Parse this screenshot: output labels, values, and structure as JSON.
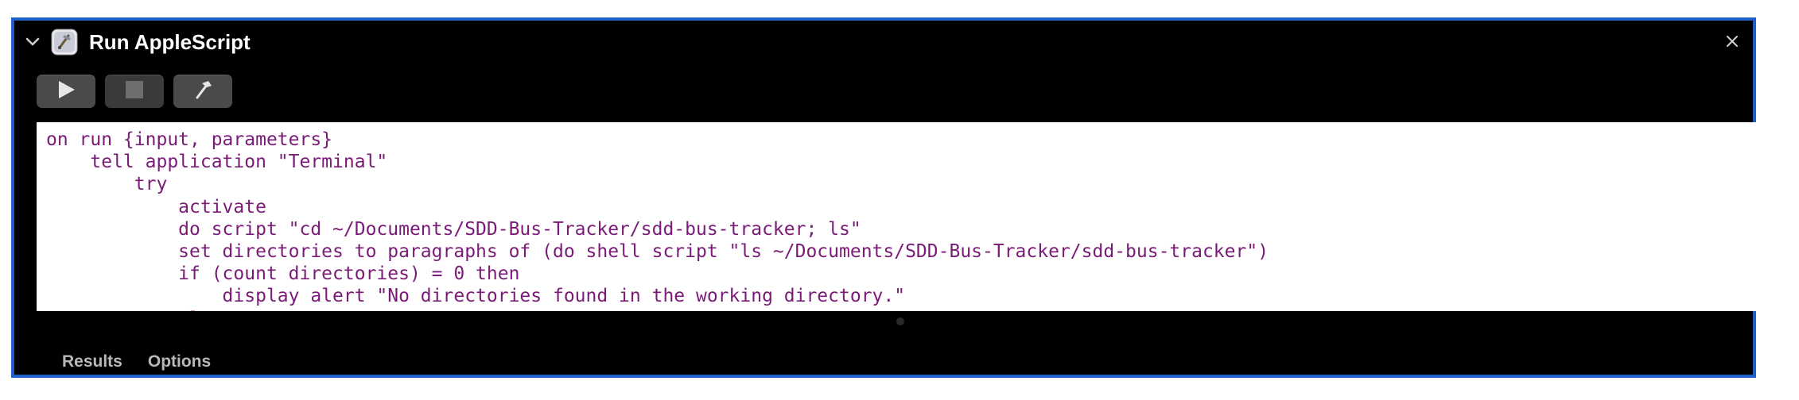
{
  "panel": {
    "title": "Run AppleScript",
    "icons": {
      "disclosure": "chevron-down-icon",
      "app": "script-editor-icon",
      "close": "close-icon"
    }
  },
  "toolbar": {
    "buttons": [
      {
        "name": "run",
        "icon": "play-icon"
      },
      {
        "name": "stop",
        "icon": "stop-icon"
      },
      {
        "name": "compile",
        "icon": "hammer-icon"
      }
    ]
  },
  "editor": {
    "code_color": "#7a1b78",
    "lines": [
      "on run {input, parameters}",
      "    tell application \"Terminal\"",
      "        try",
      "            activate",
      "            do script \"cd ~/Documents/SDD-Bus-Tracker/sdd-bus-tracker; ls\"",
      "            set directories to paragraphs of (do shell script \"ls ~/Documents/SDD-Bus-Tracker/sdd-bus-tracker\")",
      "            if (count directories) = 0 then",
      "                display alert \"No directories found in the working directory.\"",
      "            else"
    ]
  },
  "footer": {
    "tabs": [
      "Results",
      "Options"
    ]
  },
  "colors": {
    "panel_bg": "#000000",
    "panel_border": "#1f5fc8",
    "button_bg": "#3a3a3a"
  }
}
